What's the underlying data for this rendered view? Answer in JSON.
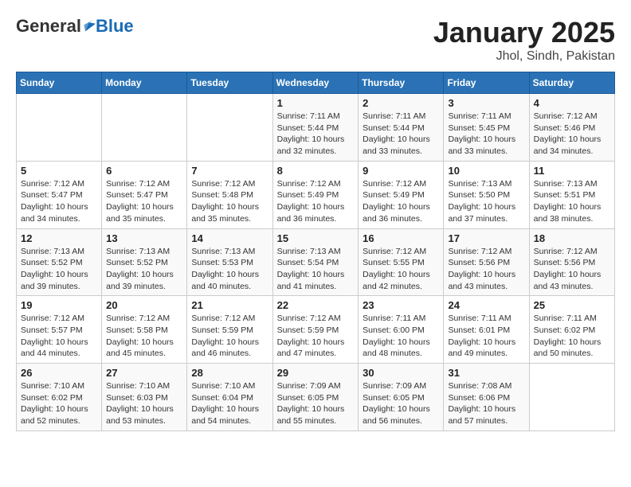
{
  "header": {
    "logo_general": "General",
    "logo_blue": "Blue",
    "title": "January 2025",
    "subtitle": "Jhol, Sindh, Pakistan"
  },
  "weekdays": [
    "Sunday",
    "Monday",
    "Tuesday",
    "Wednesday",
    "Thursday",
    "Friday",
    "Saturday"
  ],
  "weeks": [
    [
      {
        "day": "",
        "info": ""
      },
      {
        "day": "",
        "info": ""
      },
      {
        "day": "",
        "info": ""
      },
      {
        "day": "1",
        "info": "Sunrise: 7:11 AM\nSunset: 5:44 PM\nDaylight: 10 hours\nand 32 minutes."
      },
      {
        "day": "2",
        "info": "Sunrise: 7:11 AM\nSunset: 5:44 PM\nDaylight: 10 hours\nand 33 minutes."
      },
      {
        "day": "3",
        "info": "Sunrise: 7:11 AM\nSunset: 5:45 PM\nDaylight: 10 hours\nand 33 minutes."
      },
      {
        "day": "4",
        "info": "Sunrise: 7:12 AM\nSunset: 5:46 PM\nDaylight: 10 hours\nand 34 minutes."
      }
    ],
    [
      {
        "day": "5",
        "info": "Sunrise: 7:12 AM\nSunset: 5:47 PM\nDaylight: 10 hours\nand 34 minutes."
      },
      {
        "day": "6",
        "info": "Sunrise: 7:12 AM\nSunset: 5:47 PM\nDaylight: 10 hours\nand 35 minutes."
      },
      {
        "day": "7",
        "info": "Sunrise: 7:12 AM\nSunset: 5:48 PM\nDaylight: 10 hours\nand 35 minutes."
      },
      {
        "day": "8",
        "info": "Sunrise: 7:12 AM\nSunset: 5:49 PM\nDaylight: 10 hours\nand 36 minutes."
      },
      {
        "day": "9",
        "info": "Sunrise: 7:12 AM\nSunset: 5:49 PM\nDaylight: 10 hours\nand 36 minutes."
      },
      {
        "day": "10",
        "info": "Sunrise: 7:13 AM\nSunset: 5:50 PM\nDaylight: 10 hours\nand 37 minutes."
      },
      {
        "day": "11",
        "info": "Sunrise: 7:13 AM\nSunset: 5:51 PM\nDaylight: 10 hours\nand 38 minutes."
      }
    ],
    [
      {
        "day": "12",
        "info": "Sunrise: 7:13 AM\nSunset: 5:52 PM\nDaylight: 10 hours\nand 39 minutes."
      },
      {
        "day": "13",
        "info": "Sunrise: 7:13 AM\nSunset: 5:52 PM\nDaylight: 10 hours\nand 39 minutes."
      },
      {
        "day": "14",
        "info": "Sunrise: 7:13 AM\nSunset: 5:53 PM\nDaylight: 10 hours\nand 40 minutes."
      },
      {
        "day": "15",
        "info": "Sunrise: 7:13 AM\nSunset: 5:54 PM\nDaylight: 10 hours\nand 41 minutes."
      },
      {
        "day": "16",
        "info": "Sunrise: 7:12 AM\nSunset: 5:55 PM\nDaylight: 10 hours\nand 42 minutes."
      },
      {
        "day": "17",
        "info": "Sunrise: 7:12 AM\nSunset: 5:56 PM\nDaylight: 10 hours\nand 43 minutes."
      },
      {
        "day": "18",
        "info": "Sunrise: 7:12 AM\nSunset: 5:56 PM\nDaylight: 10 hours\nand 43 minutes."
      }
    ],
    [
      {
        "day": "19",
        "info": "Sunrise: 7:12 AM\nSunset: 5:57 PM\nDaylight: 10 hours\nand 44 minutes."
      },
      {
        "day": "20",
        "info": "Sunrise: 7:12 AM\nSunset: 5:58 PM\nDaylight: 10 hours\nand 45 minutes."
      },
      {
        "day": "21",
        "info": "Sunrise: 7:12 AM\nSunset: 5:59 PM\nDaylight: 10 hours\nand 46 minutes."
      },
      {
        "day": "22",
        "info": "Sunrise: 7:12 AM\nSunset: 5:59 PM\nDaylight: 10 hours\nand 47 minutes."
      },
      {
        "day": "23",
        "info": "Sunrise: 7:11 AM\nSunset: 6:00 PM\nDaylight: 10 hours\nand 48 minutes."
      },
      {
        "day": "24",
        "info": "Sunrise: 7:11 AM\nSunset: 6:01 PM\nDaylight: 10 hours\nand 49 minutes."
      },
      {
        "day": "25",
        "info": "Sunrise: 7:11 AM\nSunset: 6:02 PM\nDaylight: 10 hours\nand 50 minutes."
      }
    ],
    [
      {
        "day": "26",
        "info": "Sunrise: 7:10 AM\nSunset: 6:02 PM\nDaylight: 10 hours\nand 52 minutes."
      },
      {
        "day": "27",
        "info": "Sunrise: 7:10 AM\nSunset: 6:03 PM\nDaylight: 10 hours\nand 53 minutes."
      },
      {
        "day": "28",
        "info": "Sunrise: 7:10 AM\nSunset: 6:04 PM\nDaylight: 10 hours\nand 54 minutes."
      },
      {
        "day": "29",
        "info": "Sunrise: 7:09 AM\nSunset: 6:05 PM\nDaylight: 10 hours\nand 55 minutes."
      },
      {
        "day": "30",
        "info": "Sunrise: 7:09 AM\nSunset: 6:05 PM\nDaylight: 10 hours\nand 56 minutes."
      },
      {
        "day": "31",
        "info": "Sunrise: 7:08 AM\nSunset: 6:06 PM\nDaylight: 10 hours\nand 57 minutes."
      },
      {
        "day": "",
        "info": ""
      }
    ]
  ]
}
